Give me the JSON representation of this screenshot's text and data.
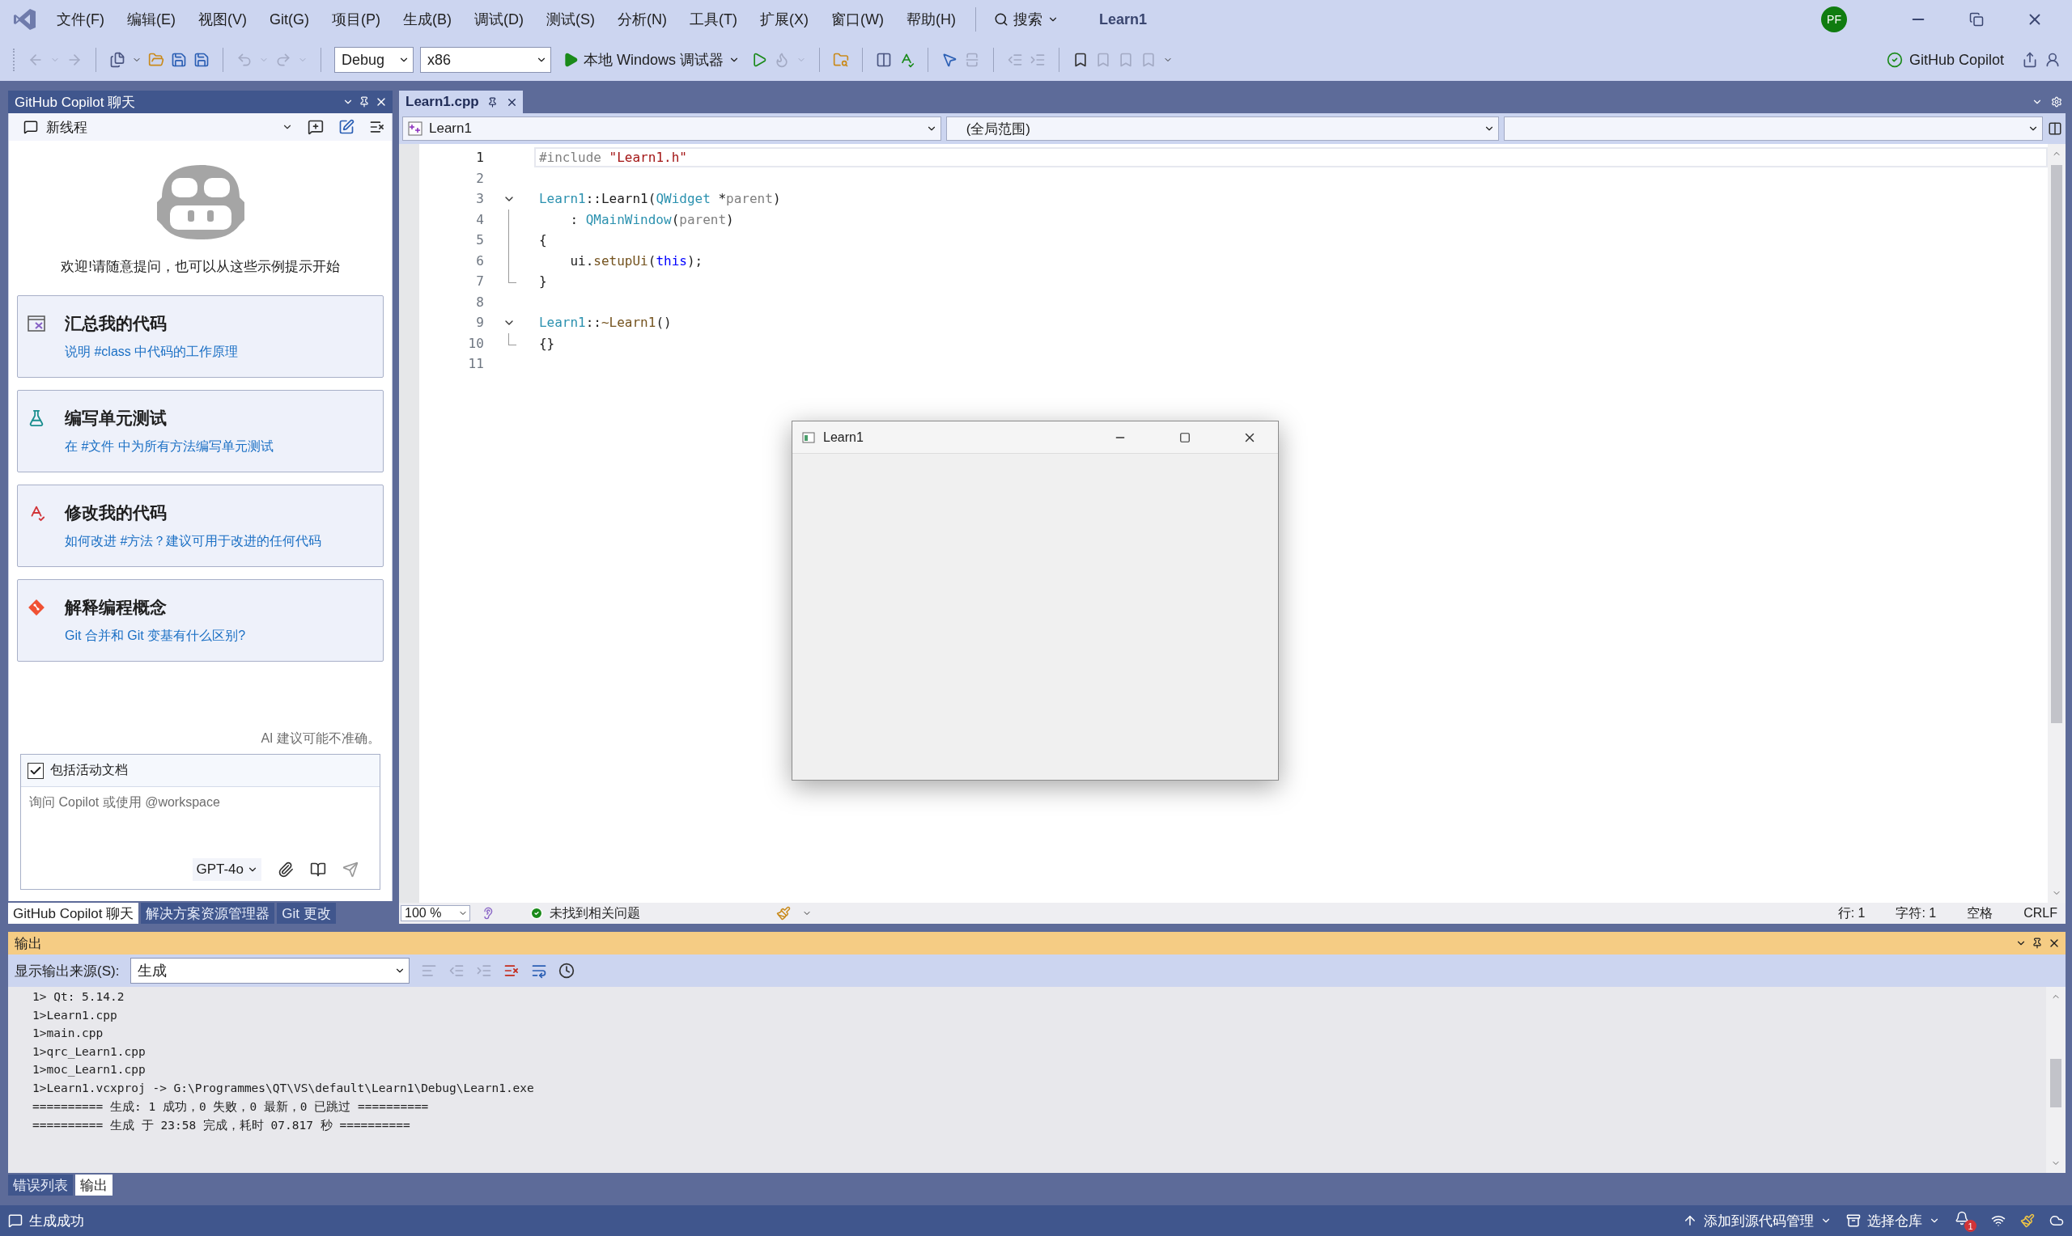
{
  "menu": [
    {
      "label": "文件(F)"
    },
    {
      "label": "编辑(E)"
    },
    {
      "label": "视图(V)"
    },
    {
      "label": "Git(G)"
    },
    {
      "label": "项目(P)"
    },
    {
      "label": "生成(B)"
    },
    {
      "label": "调试(D)"
    },
    {
      "label": "测试(S)"
    },
    {
      "label": "分析(N)"
    },
    {
      "label": "工具(T)"
    },
    {
      "label": "扩展(X)"
    },
    {
      "label": "窗口(W)"
    },
    {
      "label": "帮助(H)"
    }
  ],
  "search": {
    "label": "搜索"
  },
  "solution_name": "Learn1",
  "account": {
    "initials": "PF"
  },
  "toolbar": {
    "configuration": "Debug",
    "platform": "x86",
    "run_target": "本地 Windows 调试器"
  },
  "copilot_status": "GitHub Copilot",
  "chat_panel": {
    "title": "GitHub Copilot 聊天",
    "thread": "新线程",
    "welcome": "欢迎!请随意提问，也可以从这些示例提示开始",
    "suggestions": [
      {
        "kind": "summarize",
        "title": "汇总我的代码",
        "prompt": "说明 #class 中代码的工作原理"
      },
      {
        "kind": "test",
        "title": "编写单元测试",
        "prompt": "在 #文件 中为所有方法编写单元测试"
      },
      {
        "kind": "fix",
        "title": "修改我的代码",
        "prompt": "如何改进 #方法？建议可用于改进的任何代码"
      },
      {
        "kind": "explain",
        "title": "解释编程概念",
        "prompt": "Git 合并和 Git 变基有什么区别?"
      }
    ],
    "disclaimer": "AI 建议可能不准确。",
    "include_document": {
      "label": "包括活动文档",
      "checked": true
    },
    "input": {
      "placeholder": "询问 Copilot 或使用 @workspace"
    },
    "model": "GPT-4o",
    "tabs": [
      {
        "label": "GitHub Copilot 聊天",
        "selected": true
      },
      {
        "label": "解决方案资源管理器",
        "selected": false
      },
      {
        "label": "Git 更改",
        "selected": false
      }
    ]
  },
  "editor": {
    "tabs": [
      {
        "label": "Learn1.cpp",
        "selected": true
      }
    ],
    "navigation": {
      "class": "Learn1",
      "scope": "(全局范围)"
    },
    "lines": [
      {
        "number": "1",
        "current": true,
        "kind": "plain",
        "tokens": [
          {
            "kind": "preproc",
            "text": "#include "
          },
          {
            "kind": "string",
            "text": "\"Learn1.h\""
          }
        ]
      },
      {
        "number": "2",
        "current": false,
        "kind": "plain"
      },
      {
        "number": "3",
        "current": false,
        "kind": "start",
        "tokens": [
          {
            "kind": "type",
            "text": "Learn1"
          },
          {
            "kind": "plain",
            "text": "::Learn1("
          },
          {
            "kind": "type",
            "text": "QWidget"
          },
          {
            "kind": "plain",
            "text": " *"
          },
          {
            "kind": "param",
            "text": "parent"
          },
          {
            "kind": "plain",
            "text": ")"
          }
        ]
      },
      {
        "number": "4",
        "current": false,
        "kind": "inner",
        "tokens": [
          {
            "kind": "plain",
            "text": "    : "
          },
          {
            "kind": "type",
            "text": "QMainWindow"
          },
          {
            "kind": "plain",
            "text": "("
          },
          {
            "kind": "param",
            "text": "parent"
          },
          {
            "kind": "plain",
            "text": ")"
          }
        ]
      },
      {
        "number": "5",
        "current": false,
        "kind": "inner",
        "tokens": [
          {
            "kind": "plain",
            "text": "{"
          }
        ]
      },
      {
        "number": "6",
        "current": false,
        "kind": "inner",
        "tokens": [
          {
            "kind": "plain",
            "text": "    ui."
          },
          {
            "kind": "function",
            "text": "setupUi"
          },
          {
            "kind": "plain",
            "text": "("
          },
          {
            "kind": "keyword",
            "text": "this"
          },
          {
            "kind": "plain",
            "text": ");"
          }
        ]
      },
      {
        "number": "7",
        "current": false,
        "kind": "end",
        "tokens": [
          {
            "kind": "plain",
            "text": "}"
          }
        ]
      },
      {
        "number": "8",
        "current": false,
        "kind": "plain"
      },
      {
        "number": "9",
        "current": false,
        "kind": "start",
        "tokens": [
          {
            "kind": "type",
            "text": "Learn1"
          },
          {
            "kind": "plain",
            "text": "::"
          },
          {
            "kind": "function",
            "text": "~Learn1"
          },
          {
            "kind": "plain",
            "text": "()"
          }
        ]
      },
      {
        "number": "10",
        "current": false,
        "kind": "end",
        "tokens": [
          {
            "kind": "plain",
            "text": "{}"
          }
        ]
      },
      {
        "number": "11",
        "current": false,
        "kind": "plain"
      }
    ],
    "status": {
      "zoom": "100 %",
      "issues": "未找到相关问题",
      "line": "行: 1",
      "column": "字符: 1",
      "indent": "空格",
      "line_ending": "CRLF"
    }
  },
  "app_window": {
    "title": "Learn1"
  },
  "output": {
    "title": "输出",
    "source_label": "显示输出来源(S):",
    "source": "生成",
    "lines": [
      "1> Qt: 5.14.2",
      "1>Learn1.cpp",
      "1>main.cpp",
      "1>qrc_Learn1.cpp",
      "1>moc_Learn1.cpp",
      "1>Learn1.vcxproj -> G:\\Programmes\\QT\\VS\\default\\Learn1\\Debug\\Learn1.exe",
      "========== 生成: 1 成功，0 失败，0 最新，0 已跳过 ==========",
      "========== 生成 于 23:58 完成，耗时 07.817 秒 =========="
    ]
  },
  "bottom_tabs": [
    {
      "label": "错误列表",
      "selected": false
    },
    {
      "label": "输出",
      "selected": true
    }
  ],
  "status_bar": {
    "message": "生成成功",
    "source_control": "添加到源代码管理",
    "repository": "选择仓库",
    "notifications": "1"
  }
}
